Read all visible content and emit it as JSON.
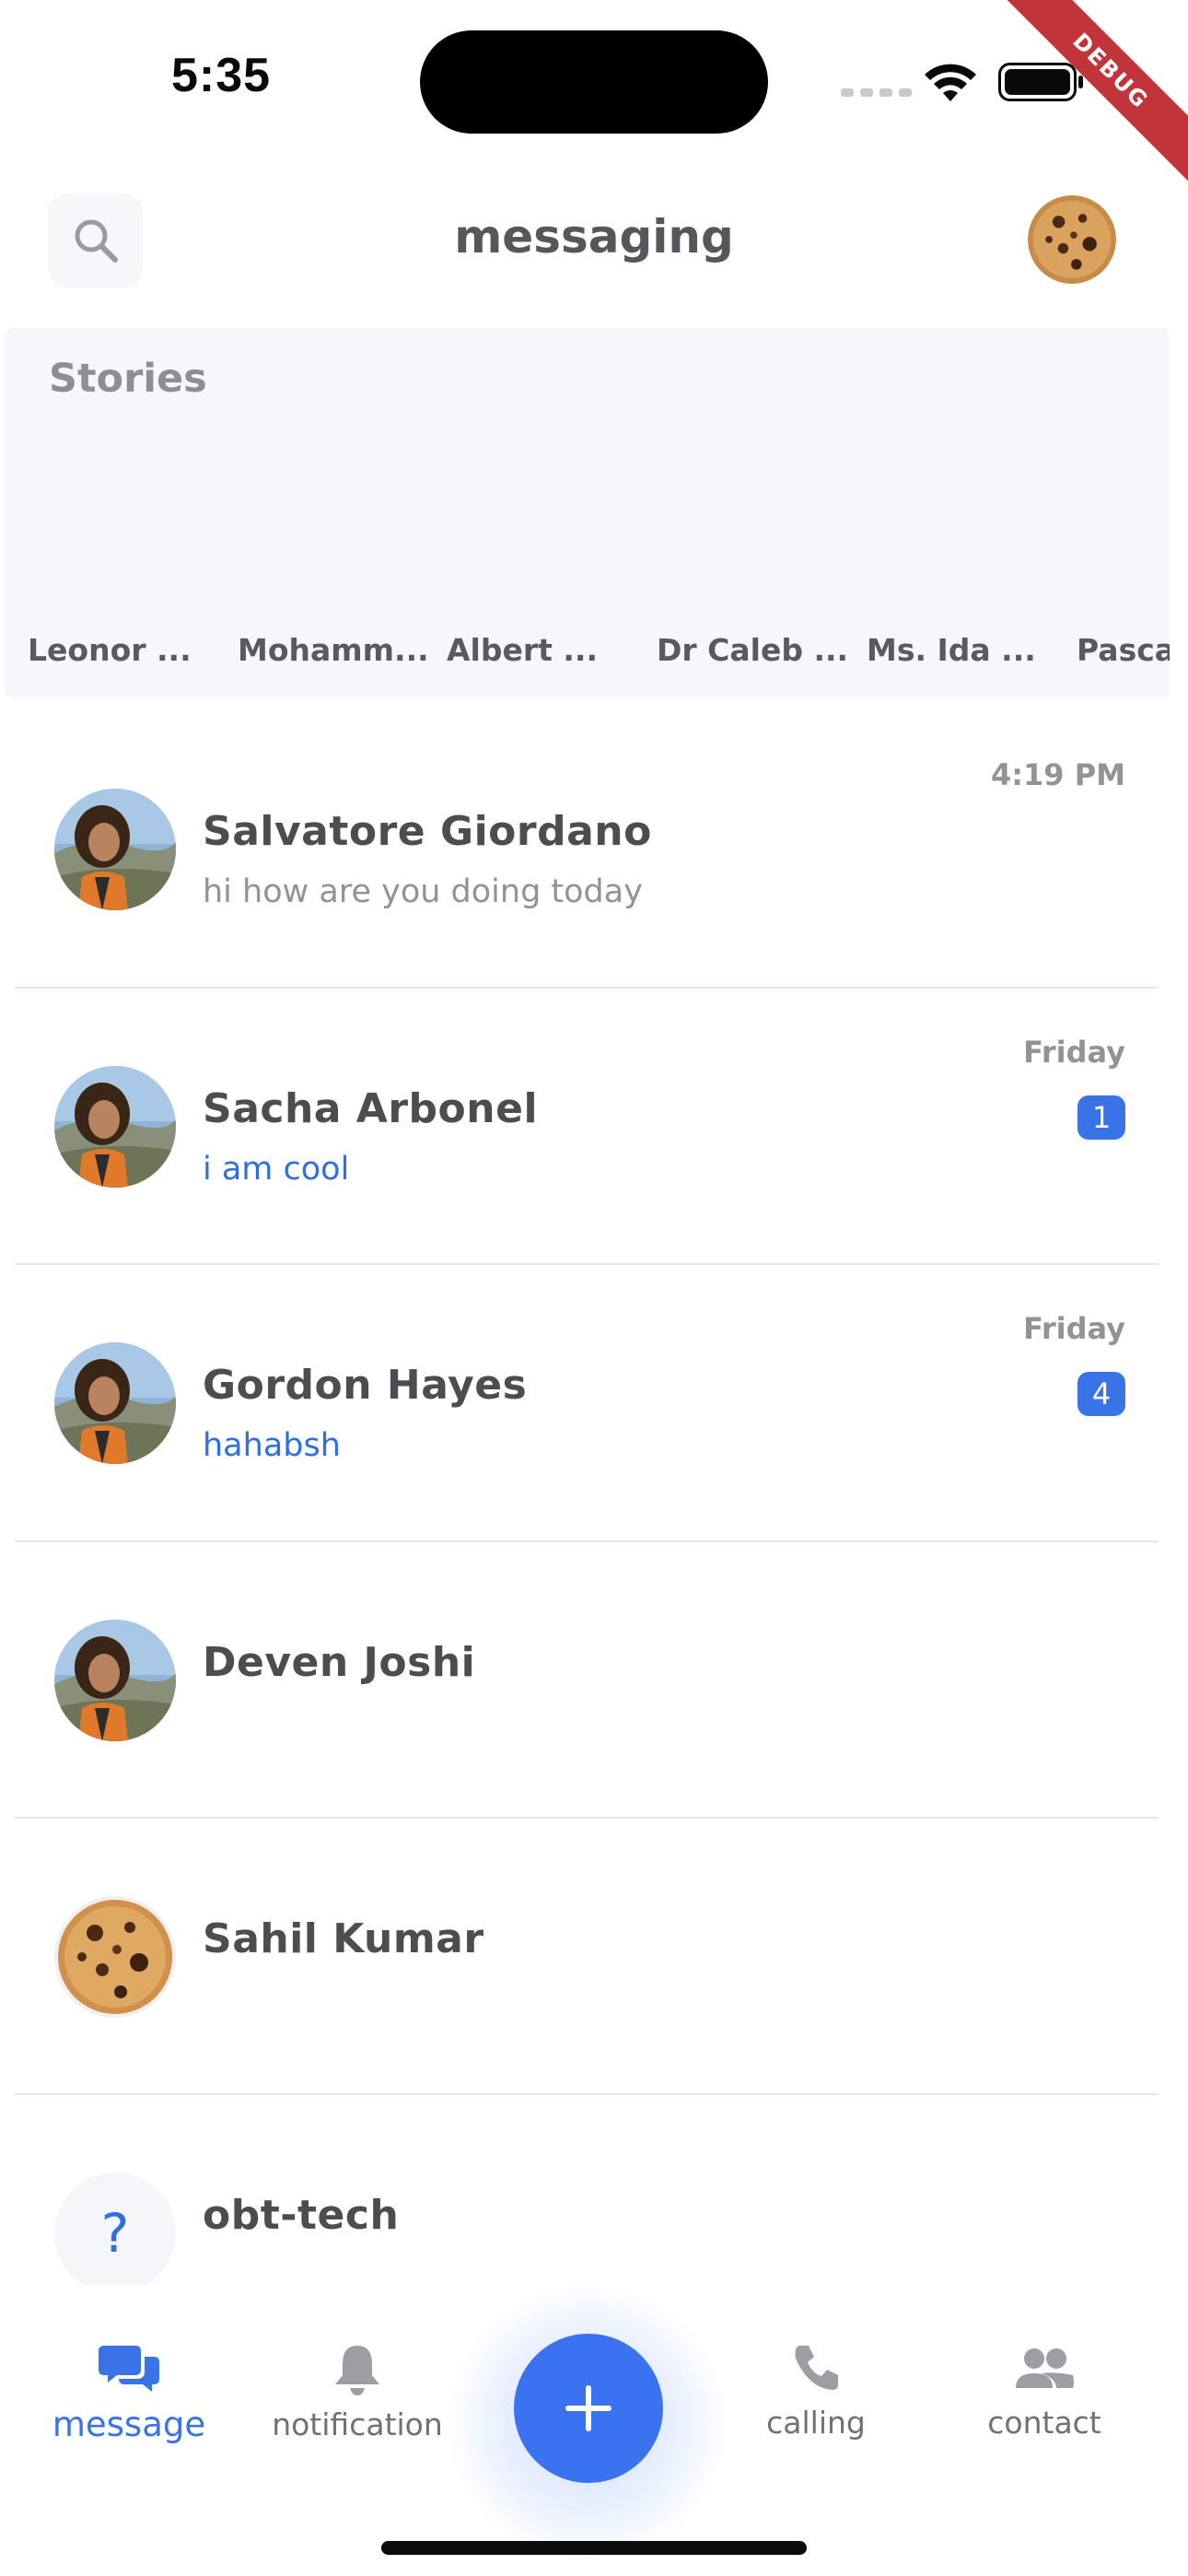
{
  "status_bar": {
    "time": "5:35",
    "debug_label": "DEBUG"
  },
  "header": {
    "title": "messaging"
  },
  "stories": {
    "title": "Stories",
    "items": [
      {
        "name": "Leonor ..."
      },
      {
        "name": "Mohamm..."
      },
      {
        "name": "Albert ..."
      },
      {
        "name": "Dr Caleb ..."
      },
      {
        "name": "Ms. Ida ..."
      },
      {
        "name": "Pascal"
      }
    ]
  },
  "conversations": [
    {
      "name": "Salvatore Giordano",
      "message": "hi how are you doing today",
      "time": "4:19 PM",
      "unread": "",
      "avatar": "photo-avatar"
    },
    {
      "name": "Sacha Arbonel",
      "message": "i am cool",
      "time": "Friday",
      "unread": "1",
      "avatar": "photo-avatar"
    },
    {
      "name": "Gordon Hayes",
      "message": "hahabsh",
      "time": "Friday",
      "unread": "4",
      "avatar": "photo-avatar"
    },
    {
      "name": "Deven Joshi",
      "message": "",
      "time": "",
      "unread": "",
      "avatar": "photo-avatar"
    },
    {
      "name": "Sahil Kumar",
      "message": "",
      "time": "",
      "unread": "",
      "avatar": "cookie-avatar"
    },
    {
      "name": "obt-tech",
      "message": "",
      "time": "",
      "unread": "",
      "avatar": "question-mark-avatar"
    }
  ],
  "bottom_nav": {
    "items": [
      {
        "label": "message",
        "icon": "chat-bubbles-icon",
        "active": true
      },
      {
        "label": "notification",
        "icon": "bell-icon",
        "active": false
      },
      {
        "label": "calling",
        "icon": "phone-icon",
        "active": false
      },
      {
        "label": "contact",
        "icon": "people-icon",
        "active": false
      }
    ],
    "fab_icon": "plus-icon"
  },
  "colors": {
    "accent": "#3a72e8",
    "text": "#4d4d51",
    "muted": "#929297",
    "debug": "#c2333a"
  }
}
